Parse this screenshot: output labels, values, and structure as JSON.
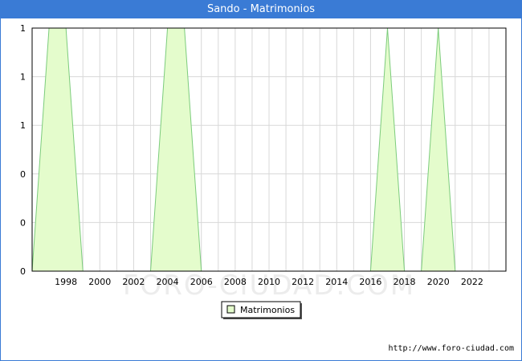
{
  "title": "Sando - Matrimonios",
  "credit": "http://www.foro-ciudad.com",
  "watermark": "FORO-CIUDAD.COM",
  "colors": {
    "title_bg": "#3a7bd5",
    "fill": "#e4fccc",
    "stroke": "#7ccc7c",
    "grid": "#d8d8d8"
  },
  "chart_data": {
    "type": "area",
    "title": "Sando - Matrimonios",
    "series": [
      {
        "name": "Matrimonios",
        "x": [
          1996,
          1997,
          1998,
          1999,
          2000,
          2001,
          2002,
          2003,
          2004,
          2005,
          2006,
          2007,
          2008,
          2009,
          2010,
          2011,
          2012,
          2013,
          2014,
          2015,
          2016,
          2017,
          2018,
          2019,
          2020,
          2021,
          2022
        ],
        "values": [
          0,
          1,
          1,
          0,
          0,
          0,
          0,
          0,
          1,
          1,
          0,
          0,
          0,
          0,
          0,
          0,
          0,
          0,
          0,
          0,
          0,
          1,
          0,
          0,
          1,
          0,
          0
        ]
      }
    ],
    "x_ticks": [
      "1998",
      "2000",
      "2002",
      "2004",
      "2006",
      "2008",
      "2010",
      "2012",
      "2014",
      "2016",
      "2018",
      "2020",
      "2022"
    ],
    "x_tick_values": [
      1998,
      2000,
      2002,
      2004,
      2006,
      2008,
      2010,
      2012,
      2014,
      2016,
      2018,
      2020,
      2022
    ],
    "y_ticks": [
      "0",
      "0",
      "0",
      "1",
      "1",
      "1"
    ],
    "y_tick_values": [
      0,
      0.2,
      0.4,
      0.6,
      0.8,
      1.0
    ],
    "xlim": [
      1996,
      2024
    ],
    "ylim": [
      0,
      1
    ],
    "grid": true,
    "legend": {
      "position": "bottom-center",
      "entries": [
        "Matrimonios"
      ]
    }
  }
}
